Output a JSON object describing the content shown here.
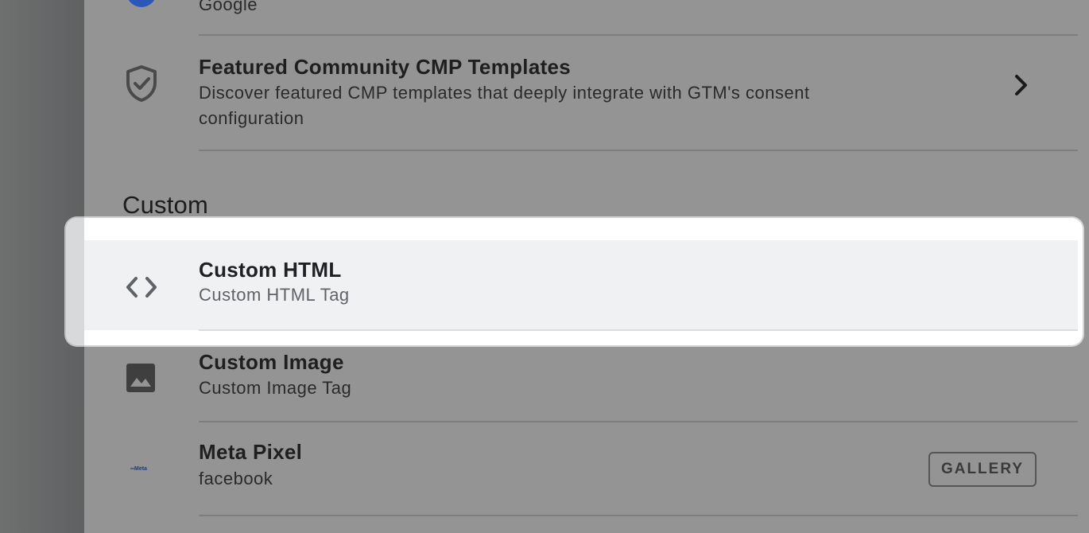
{
  "rows": {
    "google": {
      "sub": "Google"
    },
    "cmp": {
      "title": "Featured Community CMP Templates",
      "sub_line1": "Discover featured CMP templates that deeply integrate with GTM's consent",
      "sub_line2": "configuration"
    },
    "section_title": "Custom",
    "custom_html": {
      "title": "Custom HTML",
      "sub": "Custom HTML Tag"
    },
    "custom_image": {
      "title": "Custom Image",
      "sub": "Custom Image Tag"
    },
    "meta_pixel": {
      "title": "Meta Pixel",
      "sub": "facebook",
      "logo_text": "∞Meta",
      "button": "GALLERY"
    }
  },
  "icons": {
    "google": "google-logo-icon",
    "cmp": "shield-check-icon",
    "cmp_chevron": "chevron-right-icon",
    "custom_html": "code-brackets-icon",
    "custom_image": "image-icon",
    "meta_pixel": "meta-logo-icon"
  },
  "colors": {
    "panel_dim": "#949494",
    "highlight_row": "#f0f1f3",
    "spotlight": "#ffffff"
  }
}
